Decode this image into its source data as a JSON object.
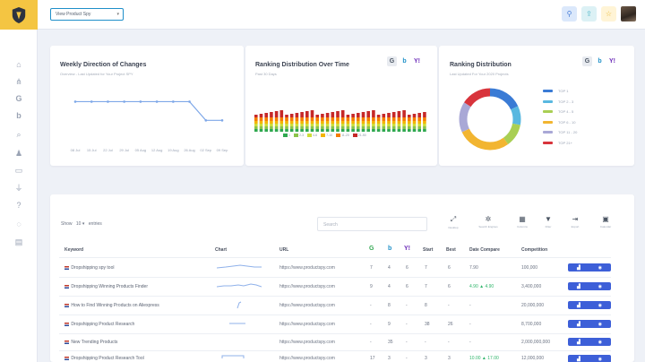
{
  "topbar": {
    "project_select": "View Product Spy",
    "icons": [
      "search-icon",
      "upload-icon",
      "star-icon"
    ]
  },
  "sidebar": {
    "icons": [
      "home-icon",
      "sitemap-icon",
      "google-icon",
      "bing-icon",
      "search-icon",
      "org-chart-icon",
      "card-icon",
      "plug-icon",
      "help-icon",
      "spinner-icon",
      "report-icon"
    ]
  },
  "weekly": {
    "title": "Weekly Direction of Changes",
    "subtitle": "Overview - Last Updated for Your Project SPY",
    "chart_data": {
      "type": "line",
      "x": [
        "08 Jul",
        "15 Jul",
        "22 Jul",
        "29 Jul",
        "05 Aug",
        "12 Aug",
        "19 Aug",
        "26 Aug",
        "02 Sep",
        "09 Sep"
      ],
      "series": [
        {
          "values": [
            2,
            2,
            2,
            2,
            2,
            2,
            2,
            2,
            1,
            1
          ]
        }
      ]
    }
  },
  "ranking_time": {
    "title": "Ranking Distribution Over Time",
    "subtitle": "Past 30 Days",
    "legend": [
      "1",
      "2-3",
      "4-6",
      "7-10",
      "11-20",
      "21-50"
    ],
    "colors": [
      "#2fa84f",
      "#8bc34a",
      "#cddc39",
      "#f4b400",
      "#f57c00",
      "#c62828"
    ]
  },
  "ranking_dist": {
    "title": "Ranking Distribution",
    "subtitle": "Last Updated For Your 2020 Projects",
    "chart_data": {
      "type": "pie",
      "categories": [
        "TOP 1",
        "TOP 2 - 3",
        "TOP 4 - 5",
        "TOP 6 - 10",
        "TOP 11 - 20",
        "TOP 21+"
      ],
      "values": [
        18,
        10,
        12,
        28,
        16,
        16
      ],
      "colors": [
        "#3a7bd5",
        "#59b8e0",
        "#a9cf54",
        "#f2b531",
        "#a9a8d6",
        "#d8343c"
      ]
    }
  },
  "table": {
    "show_label": "Show",
    "show_value": "10",
    "entries_label": "entries",
    "search_placeholder": "Search",
    "tools": [
      {
        "icon": "expand-icon",
        "label": "Desktop"
      },
      {
        "icon": "gear-icon",
        "label": "Search Engines"
      },
      {
        "icon": "grid-icon",
        "label": "Columns"
      },
      {
        "icon": "filter-icon",
        "label": "Filter"
      },
      {
        "icon": "export-icon",
        "label": "Export"
      },
      {
        "icon": "calendar-icon",
        "label": "Calendar"
      }
    ],
    "headers": [
      "Keyword",
      "Chart",
      "URL",
      "Start",
      "Best",
      "Date Compare",
      "Competition"
    ],
    "rows": [
      {
        "keyword": "Dropshipping spy tool",
        "url": "https://www.productspy.com",
        "g": "7",
        "b": "4",
        "y": "6",
        "start": "7",
        "best": "6",
        "compare": "7.90",
        "competition": "100,000"
      },
      {
        "keyword": "Dropshipping Winning Products Finder",
        "url": "https://www.productspy.com",
        "g": "9",
        "b": "4",
        "y": "6",
        "start": "7",
        "best": "6",
        "compare": "4.90 ▲ 4.90",
        "competition": "3,400,000"
      },
      {
        "keyword": "How to Find Winning Products on Aliexpress",
        "url": "https://www.productspy.com",
        "g": "-",
        "b": "8",
        "y": "-",
        "start": "8",
        "best": "-",
        "compare": "-",
        "competition": "20,000,000"
      },
      {
        "keyword": "Dropshipping Product Research",
        "url": "https://www.productspy.com",
        "g": "-",
        "b": "9",
        "y": "-",
        "start": "38",
        "best": "26",
        "compare": "-",
        "competition": "8,700,000"
      },
      {
        "keyword": "New Trending Products",
        "url": "https://www.productspy.com",
        "g": "-",
        "b": "35",
        "y": "-",
        "start": "-",
        "best": "-",
        "compare": "-",
        "competition": "2,000,000,000"
      },
      {
        "keyword": "Dropshipping Product Research Tool",
        "url": "https://www.productspy.com",
        "g": "17",
        "b": "3",
        "y": "-",
        "start": "3",
        "best": "3",
        "compare": "10.00 ▲ 17.00",
        "competition": "12,000,000"
      }
    ]
  }
}
